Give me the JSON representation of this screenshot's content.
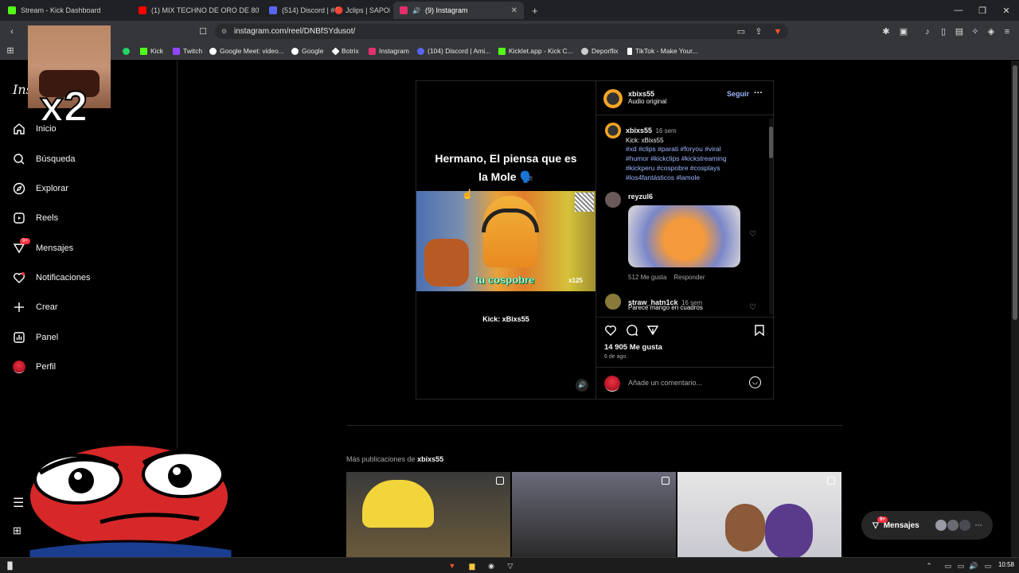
{
  "tabs": [
    {
      "title": "Stream - Kick Dashboard",
      "color": "#53fc18"
    },
    {
      "title": "(1) MIX TECHNO DE ORO DE 80's & 90",
      "color": "#ff0000"
    },
    {
      "title": "(514) Discord | #🔴 Jclips | SAPOLICE",
      "color": "#5865f2"
    },
    {
      "title": "(9) Instagram",
      "color": "#e1306c"
    }
  ],
  "url": "instagram.com/reel/DNBfSYdusot/",
  "bookmarks": [
    {
      "label": "Kick",
      "color": "#53fc18"
    },
    {
      "label": "Twitch",
      "color": "#9146ff"
    },
    {
      "label": "Google Meet: video...",
      "color": "#00ac47"
    },
    {
      "label": "Google",
      "color": "#4285f4"
    },
    {
      "label": "Botrix",
      "color": "#ffffff"
    },
    {
      "label": "Instagram",
      "color": "#e1306c"
    },
    {
      "label": "(104) Discord | Ami...",
      "color": "#5865f2"
    },
    {
      "label": "Kicklet.app - Kick C...",
      "color": "#53fc18"
    },
    {
      "label": "Deporflix",
      "color": "#cccccc"
    },
    {
      "label": "TikTok - Make Your...",
      "color": "#ffffff"
    }
  ],
  "sidebar": {
    "logo": "Ins",
    "items": [
      {
        "label": "Inicio",
        "icon": "home-icon"
      },
      {
        "label": "Búsqueda",
        "icon": "search-icon"
      },
      {
        "label": "Explorar",
        "icon": "compass-icon"
      },
      {
        "label": "Reels",
        "icon": "reels-icon"
      },
      {
        "label": "Mensajes",
        "icon": "messenger-icon",
        "badge": "9+"
      },
      {
        "label": "Notificaciones",
        "icon": "heart-icon"
      },
      {
        "label": "Crear",
        "icon": "plus-icon"
      },
      {
        "label": "Panel",
        "icon": "chart-icon"
      },
      {
        "label": "Perfil",
        "icon": "avatar"
      }
    ]
  },
  "post": {
    "overlay_text_1": "Hermano, El piensa que es",
    "overlay_text_2": "la Mole 🗣️",
    "clip_text": "tu cospobre",
    "clip_tag": "x125",
    "kick_label": "Kick: xBixs55",
    "author": "xbixs55",
    "audio": "Audio original",
    "follow": "Seguir",
    "caption_time": "16 sem",
    "caption_line": "Kick: xBixs55",
    "hashtags": "#xd #clips #parati #foryou #viral #humor #kickclips #kickstreaming #kickperu #cospobre #cosplays #los4fantásticos #lamole",
    "comments": [
      {
        "user": "reyzul6",
        "likes": "512 Me gusta",
        "reply": "Responder"
      },
      {
        "user": "straw_hatn1ck",
        "time": "16 sem",
        "text": "Parece mango en cuadros"
      }
    ],
    "likes": "14 905 Me gusta",
    "date": "6 de ago.",
    "add_comment_placeholder": "Añade un comentario..."
  },
  "more_posts": {
    "prefix": "Más publicaciones de",
    "user": "xbixs55"
  },
  "messages_pill": {
    "label": "Mensajes",
    "badge": "9+"
  },
  "overlay_emote": {
    "text": "x2"
  },
  "taskbar": {
    "time": "10:58"
  }
}
